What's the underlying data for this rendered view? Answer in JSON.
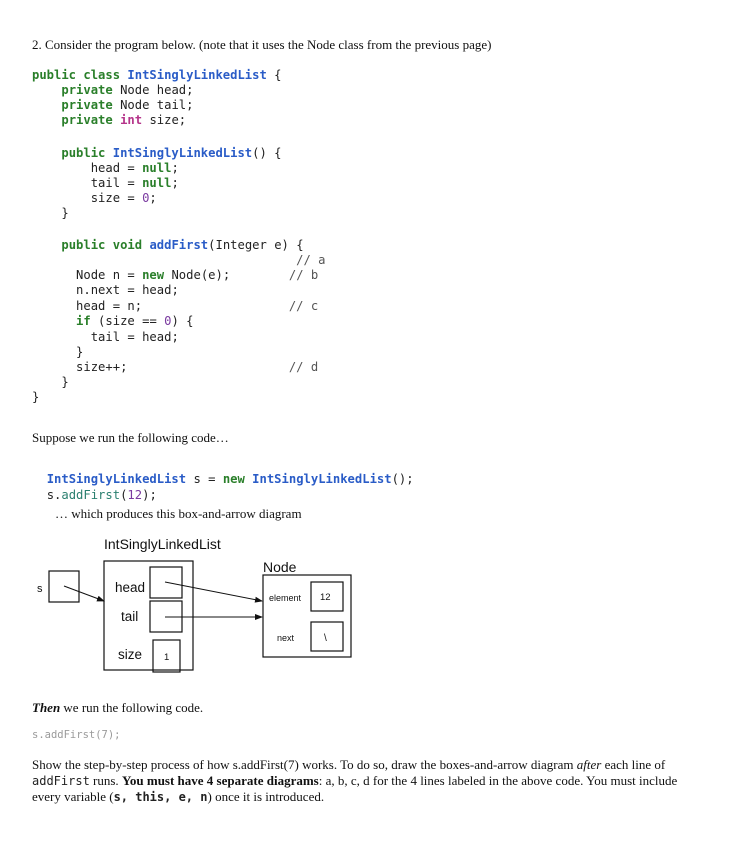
{
  "question": {
    "heading": "2. Consider the program below. (note that it uses the Node class from the previous page)"
  },
  "code": {
    "lines": [
      "public class IntSinglyLinkedList {",
      "    private Node head;",
      "    private Node tail;",
      "    private int size;",
      "",
      "    public IntSinglyLinkedList() {",
      "        head = null;",
      "        tail = null;",
      "        size = 0;",
      "    }",
      "",
      "    public void addFirst(Integer e) {",
      "                                    // a",
      "      Node n = new Node(e);        // b",
      "      n.next = head;",
      "      head = n;                    // c",
      "      if (size == 0) {",
      "        tail = head;",
      "      }",
      "      size++;                      // d",
      "    }",
      "}"
    ]
  },
  "suppose_text": "Suppose we run the following code…",
  "run_code": {
    "line1": "IntSinglyLinkedList s = new IntSinglyLinkedList();",
    "line2": "s.addFirst(12);"
  },
  "produces_text": "… which produces this box-and-arrow diagram",
  "diagram": {
    "list_title": "IntSinglyLinkedList",
    "var_s": "s",
    "field_head": "head",
    "field_tail": "tail",
    "field_size": "size",
    "size_value": "1",
    "node_title": "Node",
    "field_element": "element",
    "element_value": "12",
    "field_next": "next",
    "next_value": "\\"
  },
  "then_text": {
    "bold_italic": "Then",
    "rest": " we run the following code."
  },
  "then_code": "s.addFirst(7);",
  "instructions": {
    "p1": "Show the step-by-step process of how s.addFirst(7) works. To do so, draw the boxes-and-arrow diagram ",
    "after": "after",
    "p2": " each line of",
    "code_addFirst": "addFirst",
    "p3": " runs. ",
    "bold": "You must have 4 separate diagrams",
    "p4": ": a, b, c, d for the 4 lines labeled in the above code. You must include",
    "p5": "every variable (",
    "vars": "s, this, e, n",
    "p6": ") once it is introduced."
  }
}
